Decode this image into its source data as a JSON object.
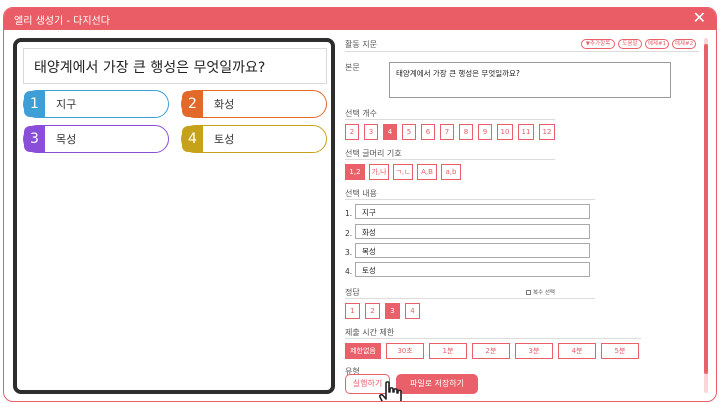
{
  "window": {
    "title": "엘리 생성기 - 다지선다"
  },
  "preview": {
    "question": "태양계에서 가장 큰 행성은 무엇일까요?",
    "options": [
      {
        "num": "1",
        "text": "지구",
        "color": "#3d9fd6"
      },
      {
        "num": "2",
        "text": "화성",
        "color": "#e2692a"
      },
      {
        "num": "3",
        "text": "목성",
        "color": "#8a4fd8"
      },
      {
        "num": "4",
        "text": "토성",
        "color": "#c6a21a"
      }
    ]
  },
  "settings": {
    "activity_label": "활동 지문",
    "pills": [
      "▼추가항목",
      "도움말",
      "예제#1",
      "예제#2"
    ],
    "body_label": "본문",
    "body_text": "태양계에서 가장 큰 행성은 무엇일까요?",
    "choice_count_label": "선택 개수",
    "choice_counts": [
      "2",
      "3",
      "4",
      "5",
      "6",
      "7",
      "8",
      "9",
      "10",
      "11",
      "12"
    ],
    "choice_count_selected": "4",
    "bullet_label": "선택 글머리 기호",
    "bullets": [
      "1,2",
      "가,나",
      "ㄱ,ㄴ",
      "A,B",
      "a,b"
    ],
    "bullet_selected": "1,2",
    "content_label": "선택 내용",
    "contents": [
      {
        "num": "1.",
        "value": "지구"
      },
      {
        "num": "2.",
        "value": "화성"
      },
      {
        "num": "3.",
        "value": "목성"
      },
      {
        "num": "4.",
        "value": "토성"
      }
    ],
    "answer_label": "정답",
    "multi_select_label": "복수 선택",
    "answers": [
      "1",
      "2",
      "3",
      "4"
    ],
    "answer_selected": "3",
    "time_label": "제출 시간 제한",
    "times": [
      "제한없음",
      "30초",
      "1분",
      "2분",
      "3분",
      "4분",
      "5분"
    ],
    "time_selected": "제한없음",
    "cutoff_label": "유형"
  },
  "buttons": {
    "run": "실행하기",
    "save": "파일로 저장하기"
  },
  "colors": {
    "accent": "#e9606a",
    "frame": "#2d2d2d"
  }
}
